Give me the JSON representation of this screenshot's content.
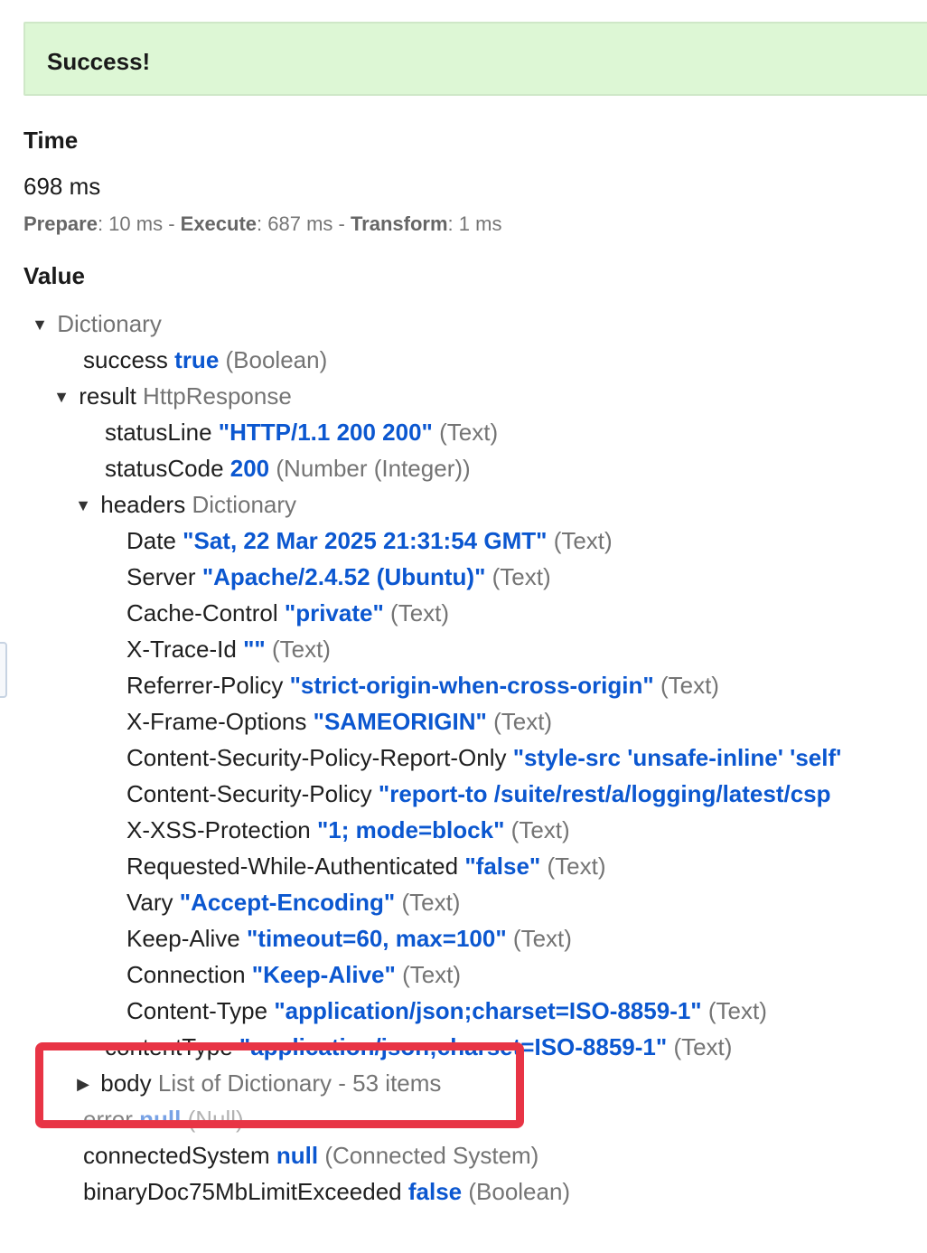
{
  "banner": {
    "title": "Success!"
  },
  "time": {
    "heading": "Time",
    "total": "698 ms",
    "prepare_label": "Prepare",
    "prepare_value": ": 10 ms - ",
    "execute_label": "Execute",
    "execute_value": ": 687 ms - ",
    "transform_label": "Transform",
    "transform_value": ": 1 ms"
  },
  "value": {
    "heading": "Value"
  },
  "tree": {
    "root": {
      "toggle": "▼",
      "type": "Dictionary"
    },
    "success": {
      "key": "success",
      "value": "true",
      "type": "(Boolean)"
    },
    "result": {
      "toggle": "▼",
      "key": "result",
      "type": "HttpResponse",
      "statusLine": {
        "key": "statusLine",
        "value": "\"HTTP/1.1 200 200\"",
        "type": "(Text)"
      },
      "statusCode": {
        "key": "statusCode",
        "value": "200",
        "type": "(Number (Integer))"
      },
      "headers": {
        "toggle": "▼",
        "key": "headers",
        "type": "Dictionary",
        "items": [
          {
            "key": "Date",
            "value": "\"Sat, 22 Mar 2025 21:31:54 GMT\"",
            "type": "(Text)"
          },
          {
            "key": "Server",
            "value": "\"Apache/2.4.52 (Ubuntu)\"",
            "type": "(Text)"
          },
          {
            "key": "Cache-Control",
            "value": "\"private\"",
            "type": "(Text)"
          },
          {
            "key": "X-Trace-Id",
            "value": "\"\"",
            "type": "(Text)"
          },
          {
            "key": "Referrer-Policy",
            "value": "\"strict-origin-when-cross-origin\"",
            "type": "(Text)"
          },
          {
            "key": "X-Frame-Options",
            "value": "\"SAMEORIGIN\"",
            "type": "(Text)"
          },
          {
            "key": "Content-Security-Policy-Report-Only",
            "value": "\"style-src 'unsafe-inline' 'self'",
            "type": ""
          },
          {
            "key": "Content-Security-Policy",
            "value": "\"report-to /suite/rest/a/logging/latest/csp",
            "type": ""
          },
          {
            "key": "X-XSS-Protection",
            "value": "\"1; mode=block\"",
            "type": "(Text)"
          },
          {
            "key": "Requested-While-Authenticated",
            "value": "\"false\"",
            "type": "(Text)"
          },
          {
            "key": "Vary",
            "value": "\"Accept-Encoding\"",
            "type": "(Text)"
          },
          {
            "key": "Keep-Alive",
            "value": "\"timeout=60, max=100\"",
            "type": "(Text)"
          },
          {
            "key": "Connection",
            "value": "\"Keep-Alive\"",
            "type": "(Text)"
          },
          {
            "key": "Content-Type",
            "value": "\"application/json;charset=ISO-8859-1\"",
            "type": "(Text)"
          }
        ]
      },
      "contentType": {
        "key": "contentType",
        "value": "\"application/json;charset=ISO-8859-1\"",
        "type": "(Text)"
      },
      "body": {
        "toggle": "▶",
        "key": "body",
        "type": "List of Dictionary - 53 items"
      }
    },
    "error": {
      "key": "error",
      "value": "null",
      "type": "(Null)"
    },
    "connectedSystem": {
      "key": "connectedSystem",
      "value": "null",
      "type": "(Connected System)"
    },
    "binaryDoc75MbLimitExceeded": {
      "key": "binaryDoc75MbLimitExceeded",
      "value": "false",
      "type": "(Boolean)"
    }
  },
  "annotation": {
    "highlight_color": "#e83445"
  }
}
